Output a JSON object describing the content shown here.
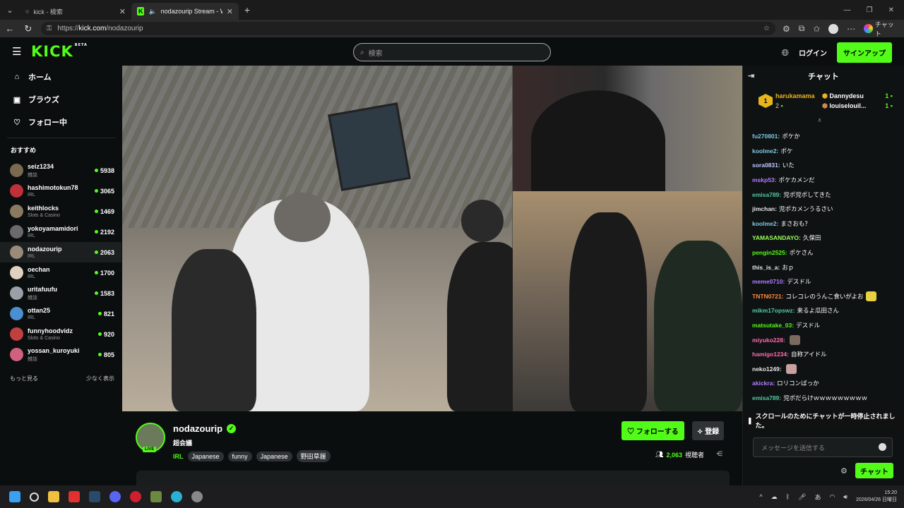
{
  "browser": {
    "tabs": [
      {
        "title": "kick - 検索",
        "active": false
      },
      {
        "title": "nodazourip Stream - Watch L",
        "active": true
      }
    ],
    "url_prefix": "https://",
    "url_host": "kick.com",
    "url_path": "/nodazourip",
    "copilot_label": "チャット"
  },
  "header": {
    "logo": "KICK",
    "beta": "BETA",
    "search_placeholder": "検索",
    "login": "ログイン",
    "signup": "サインアップ"
  },
  "sidebar": {
    "nav": [
      {
        "label": "ホーム",
        "icon": "home-icon"
      },
      {
        "label": "ブラウズ",
        "icon": "browse-icon"
      },
      {
        "label": "フォロー中",
        "icon": "heart-icon"
      }
    ],
    "recommended_title": "おすすめ",
    "channels": [
      {
        "name": "seiz1234",
        "category": "雑談",
        "viewers": "5938",
        "color": "#7a6a50"
      },
      {
        "name": "hashimotokun78",
        "category": "IRL",
        "viewers": "3065",
        "color": "#c0303a"
      },
      {
        "name": "keithlocks",
        "category": "Slots & Casino",
        "viewers": "1469",
        "color": "#8a7a60"
      },
      {
        "name": "yokoyamamidori",
        "category": "IRL",
        "viewers": "2192",
        "color": "#6a6a6a"
      },
      {
        "name": "nodazourip",
        "category": "IRL",
        "viewers": "2063",
        "color": "#9a8a7a"
      },
      {
        "name": "oechan",
        "category": "IRL",
        "viewers": "1700",
        "color": "#e0d0c0"
      },
      {
        "name": "uritafuufu",
        "category": "雑談",
        "viewers": "1583",
        "color": "#9aa0a8"
      },
      {
        "name": "ottan25",
        "category": "IRL",
        "viewers": "821",
        "color": "#4a90d0"
      },
      {
        "name": "funnyhoodvidz",
        "category": "Slots & Casino",
        "viewers": "920",
        "color": "#c04040"
      },
      {
        "name": "yossan_kuroyuki",
        "category": "雑談",
        "viewers": "805",
        "color": "#d06080"
      }
    ],
    "show_more": "もっと見る",
    "show_less": "少なく表示"
  },
  "stream": {
    "channel": "nodazourip",
    "title": "超会議",
    "live_badge": "LIVE",
    "category": "IRL",
    "tags": [
      "Japanese",
      "funny",
      "Japanese",
      "野田草履"
    ],
    "follow_label": "フォローする",
    "subscribe_label": "登録",
    "viewers": "2,063",
    "viewers_label": "視聴者"
  },
  "chat": {
    "title": "チャット",
    "gifters": {
      "top_rank": "1",
      "top_name": "harukamama",
      "top_count": "2",
      "second_name": "Dannydesu",
      "second_count": "1",
      "third_name": "louiselouil...",
      "third_count": "1"
    },
    "messages": [
      {
        "user": "fu270801",
        "text": "ポケか",
        "color": "#7ec8e3"
      },
      {
        "user": "koolme2",
        "text": "ポケ",
        "color": "#7ec8e3"
      },
      {
        "user": "sora0831",
        "text": "いた",
        "color": "#c0c8ff"
      },
      {
        "user": "mskp53",
        "text": "ポケカメンだ",
        "color": "#b07cff"
      },
      {
        "user": "emisa789",
        "text": "児ポ児ポしてきた",
        "color": "#53c8a0"
      },
      {
        "user": "jimchan",
        "text": "児ポカメンうるさい",
        "color": "#e6e6e6"
      },
      {
        "user": "koolme2",
        "text": "まさおも？",
        "color": "#7ec8e3"
      },
      {
        "user": "YAMASANDAYO",
        "text": "久保田",
        "color": "#9aff5a"
      },
      {
        "user": "pengin2525",
        "text": "ポケさん",
        "color": "#53fc18"
      },
      {
        "user": "this_is_a",
        "text": "おｐ",
        "color": "#e6e6e6"
      },
      {
        "user": "meme0710",
        "text": "デスドル",
        "color": "#b07cff"
      },
      {
        "user": "TNTN0721",
        "text": "コレコレのうんこ食いがよお",
        "color": "#ff8c3a",
        "emote": "#e8d040"
      },
      {
        "user": "mikm17opswz",
        "text": "来るよ瓜田さん",
        "color": "#53c8a0"
      },
      {
        "user": "matsutake_03",
        "text": "デスドル",
        "color": "#53fc18"
      },
      {
        "user": "miyuko228",
        "text": "",
        "color": "#ff6ab0",
        "emote": "#7a6a60"
      },
      {
        "user": "hamigo1234",
        "text": "自称アイドル",
        "color": "#ff6ab0"
      },
      {
        "user": "neko1249",
        "text": "",
        "color": "#e6e6e6",
        "emote": "#c8a0a0"
      },
      {
        "user": "akickra",
        "text": "ロリコンばっか",
        "color": "#b07cff"
      },
      {
        "user": "emisa789",
        "text": "児ポだらけｗｗｗｗｗｗｗｗｗ",
        "color": "#53c8a0"
      }
    ],
    "paused_notice": "スクロールのためにチャットが一時停止されました。",
    "input_placeholder": "メッセージを送信する",
    "send_label": "チャット"
  },
  "taskbar": {
    "time": "15:20",
    "date": "2026/04/26 日曜日"
  }
}
